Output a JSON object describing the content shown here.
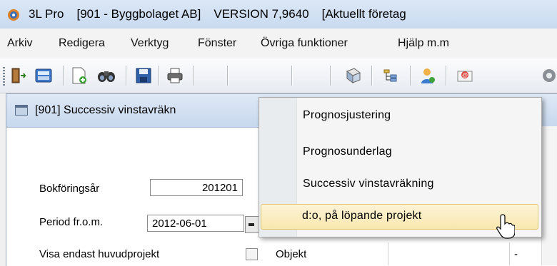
{
  "window": {
    "app_name": "3L Pro",
    "company": "[901 - Byggbolaget AB]",
    "version": "VERSION 7,9640",
    "current_company_label": "[Aktuellt företag"
  },
  "menubar": {
    "items": [
      {
        "label": "Arkiv"
      },
      {
        "label": "Redigera"
      },
      {
        "label": "Verktyg"
      },
      {
        "label": "Fönster"
      },
      {
        "label": "Övriga funktioner"
      },
      {
        "label": "Hjälp m.m"
      }
    ]
  },
  "toolbar": {
    "buttons": [
      {
        "icon": "exit-door-icon"
      },
      {
        "icon": "calculator-icon"
      },
      {
        "icon": "new-document-icon"
      },
      {
        "icon": "binoculars-icon"
      },
      {
        "icon": "save-floppy-icon"
      },
      {
        "icon": "printer-icon"
      },
      {
        "icon": "report-icon"
      },
      {
        "icon": "tree-view-icon"
      },
      {
        "icon": "user-icon"
      },
      {
        "icon": "email-icon"
      },
      {
        "icon": "gear-icon"
      }
    ]
  },
  "child_window": {
    "title": "[901]  Successiv vinstavräkn",
    "form": {
      "year_label": "Bokföringsår",
      "year_value": "201201",
      "period_label": "Period fr.o.m.",
      "period_value": "2012-06-01",
      "main_only_label": "Visa endast huvudprojekt",
      "object_label": "Objekt",
      "grid_dash": "-"
    }
  },
  "popup_menu": {
    "items": [
      {
        "label": "Prognosjustering"
      },
      {
        "label": "Prognosunderlag"
      },
      {
        "label": "Successiv vinstavräkning"
      },
      {
        "label": "d:o, på löpande projekt"
      }
    ],
    "highlighted_index": 3
  },
  "colors": {
    "highlight_fill": "#f8e7ae",
    "highlight_border": "#e4c66d",
    "title_bar": "#c9daf0"
  }
}
